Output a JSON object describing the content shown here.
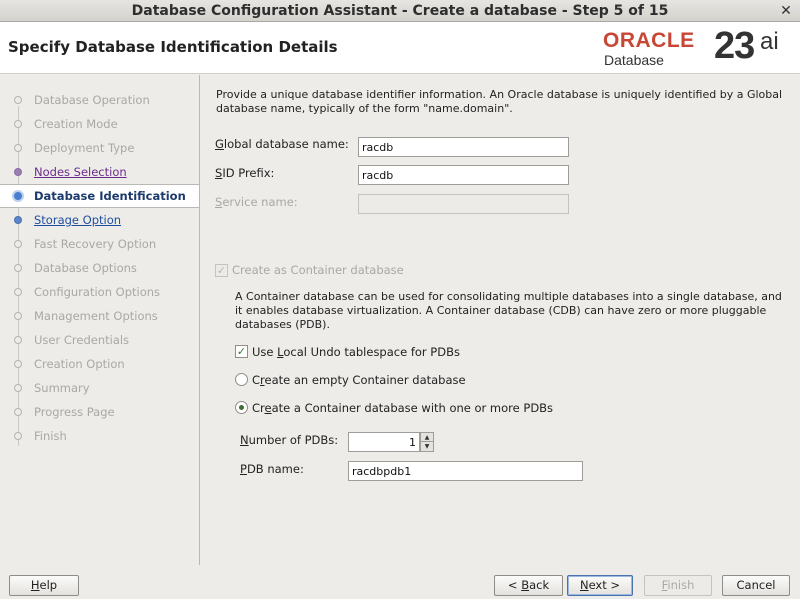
{
  "window": {
    "title": "Database Configuration Assistant - Create a database - Step 5 of 15",
    "close_glyph": "✕"
  },
  "header": {
    "page_title": "Specify Database Identification Details",
    "logo": {
      "brand": "ORACLE",
      "product": "Database",
      "version": "23",
      "version_suffix": "ai",
      "brand_color": "#c74634"
    }
  },
  "steps": [
    {
      "label": "Database Operation",
      "state": "disabled"
    },
    {
      "label": "Creation Mode",
      "state": "disabled"
    },
    {
      "label": "Deployment Type",
      "state": "disabled"
    },
    {
      "label": "Nodes Selection",
      "state": "visited"
    },
    {
      "label": "Database Identification",
      "state": "current"
    },
    {
      "label": "Storage Option",
      "state": "link"
    },
    {
      "label": "Fast Recovery Option",
      "state": "disabled"
    },
    {
      "label": "Database Options",
      "state": "disabled"
    },
    {
      "label": "Configuration Options",
      "state": "disabled"
    },
    {
      "label": "Management Options",
      "state": "disabled"
    },
    {
      "label": "User Credentials",
      "state": "disabled"
    },
    {
      "label": "Creation Option",
      "state": "disabled"
    },
    {
      "label": "Summary",
      "state": "disabled"
    },
    {
      "label": "Progress Page",
      "state": "disabled"
    },
    {
      "label": "Finish",
      "state": "disabled"
    }
  ],
  "form": {
    "description": "Provide a unique database identifier information. An Oracle database is uniquely identified by a Global database name, typically of the form \"name.domain\".",
    "global_db_name": {
      "mnemonic": "G",
      "label_rest": "lobal database name:",
      "value": "racdb"
    },
    "sid_prefix": {
      "mnemonic": "S",
      "label_rest": "ID Prefix:",
      "value": "racdb"
    },
    "service_name": {
      "mnemonic": "S",
      "label_rest": "ervice name:",
      "value": ""
    },
    "container_db": {
      "label": "Create as Container database",
      "checked": true,
      "enabled": false
    },
    "container_info": "A Container database can be used for consolidating multiple databases into a single database, and it enables database virtualization. A Container database (CDB) can have zero or more pluggable databases (PDB).",
    "local_undo": {
      "label_before": "Use ",
      "mnemonic": "L",
      "label_rest": "ocal Undo tablespace for PDBs",
      "checked": true
    },
    "empty_cdb": {
      "label_before": "C",
      "mnemonic": "r",
      "label_rest": "eate an empty Container database",
      "selected": false
    },
    "cdb_with_pdbs": {
      "label_before": "Cr",
      "mnemonic": "e",
      "label_rest": "ate a Container database with one or more PDBs",
      "selected": true
    },
    "num_pdbs": {
      "mnemonic": "N",
      "label_rest": "umber of PDBs:",
      "value": "1",
      "up_glyph": "▲",
      "down_glyph": "▼"
    },
    "pdb_name": {
      "mnemonic": "P",
      "label_rest": "DB name:",
      "value": "racdbpdb1"
    }
  },
  "buttons": {
    "help": {
      "mnemonic": "H",
      "rest": "elp"
    },
    "back": {
      "before": "< ",
      "mnemonic": "B",
      "rest": "ack"
    },
    "next": {
      "mnemonic": "N",
      "rest": "ext >"
    },
    "finish": {
      "mnemonic": "F",
      "rest": "inish"
    },
    "cancel": {
      "label": "Cancel"
    }
  },
  "colors": {
    "accent": "#1d3a6e",
    "link": "#1f4fa0",
    "visited": "#6b2c8a",
    "check": "#2d7a2a"
  }
}
